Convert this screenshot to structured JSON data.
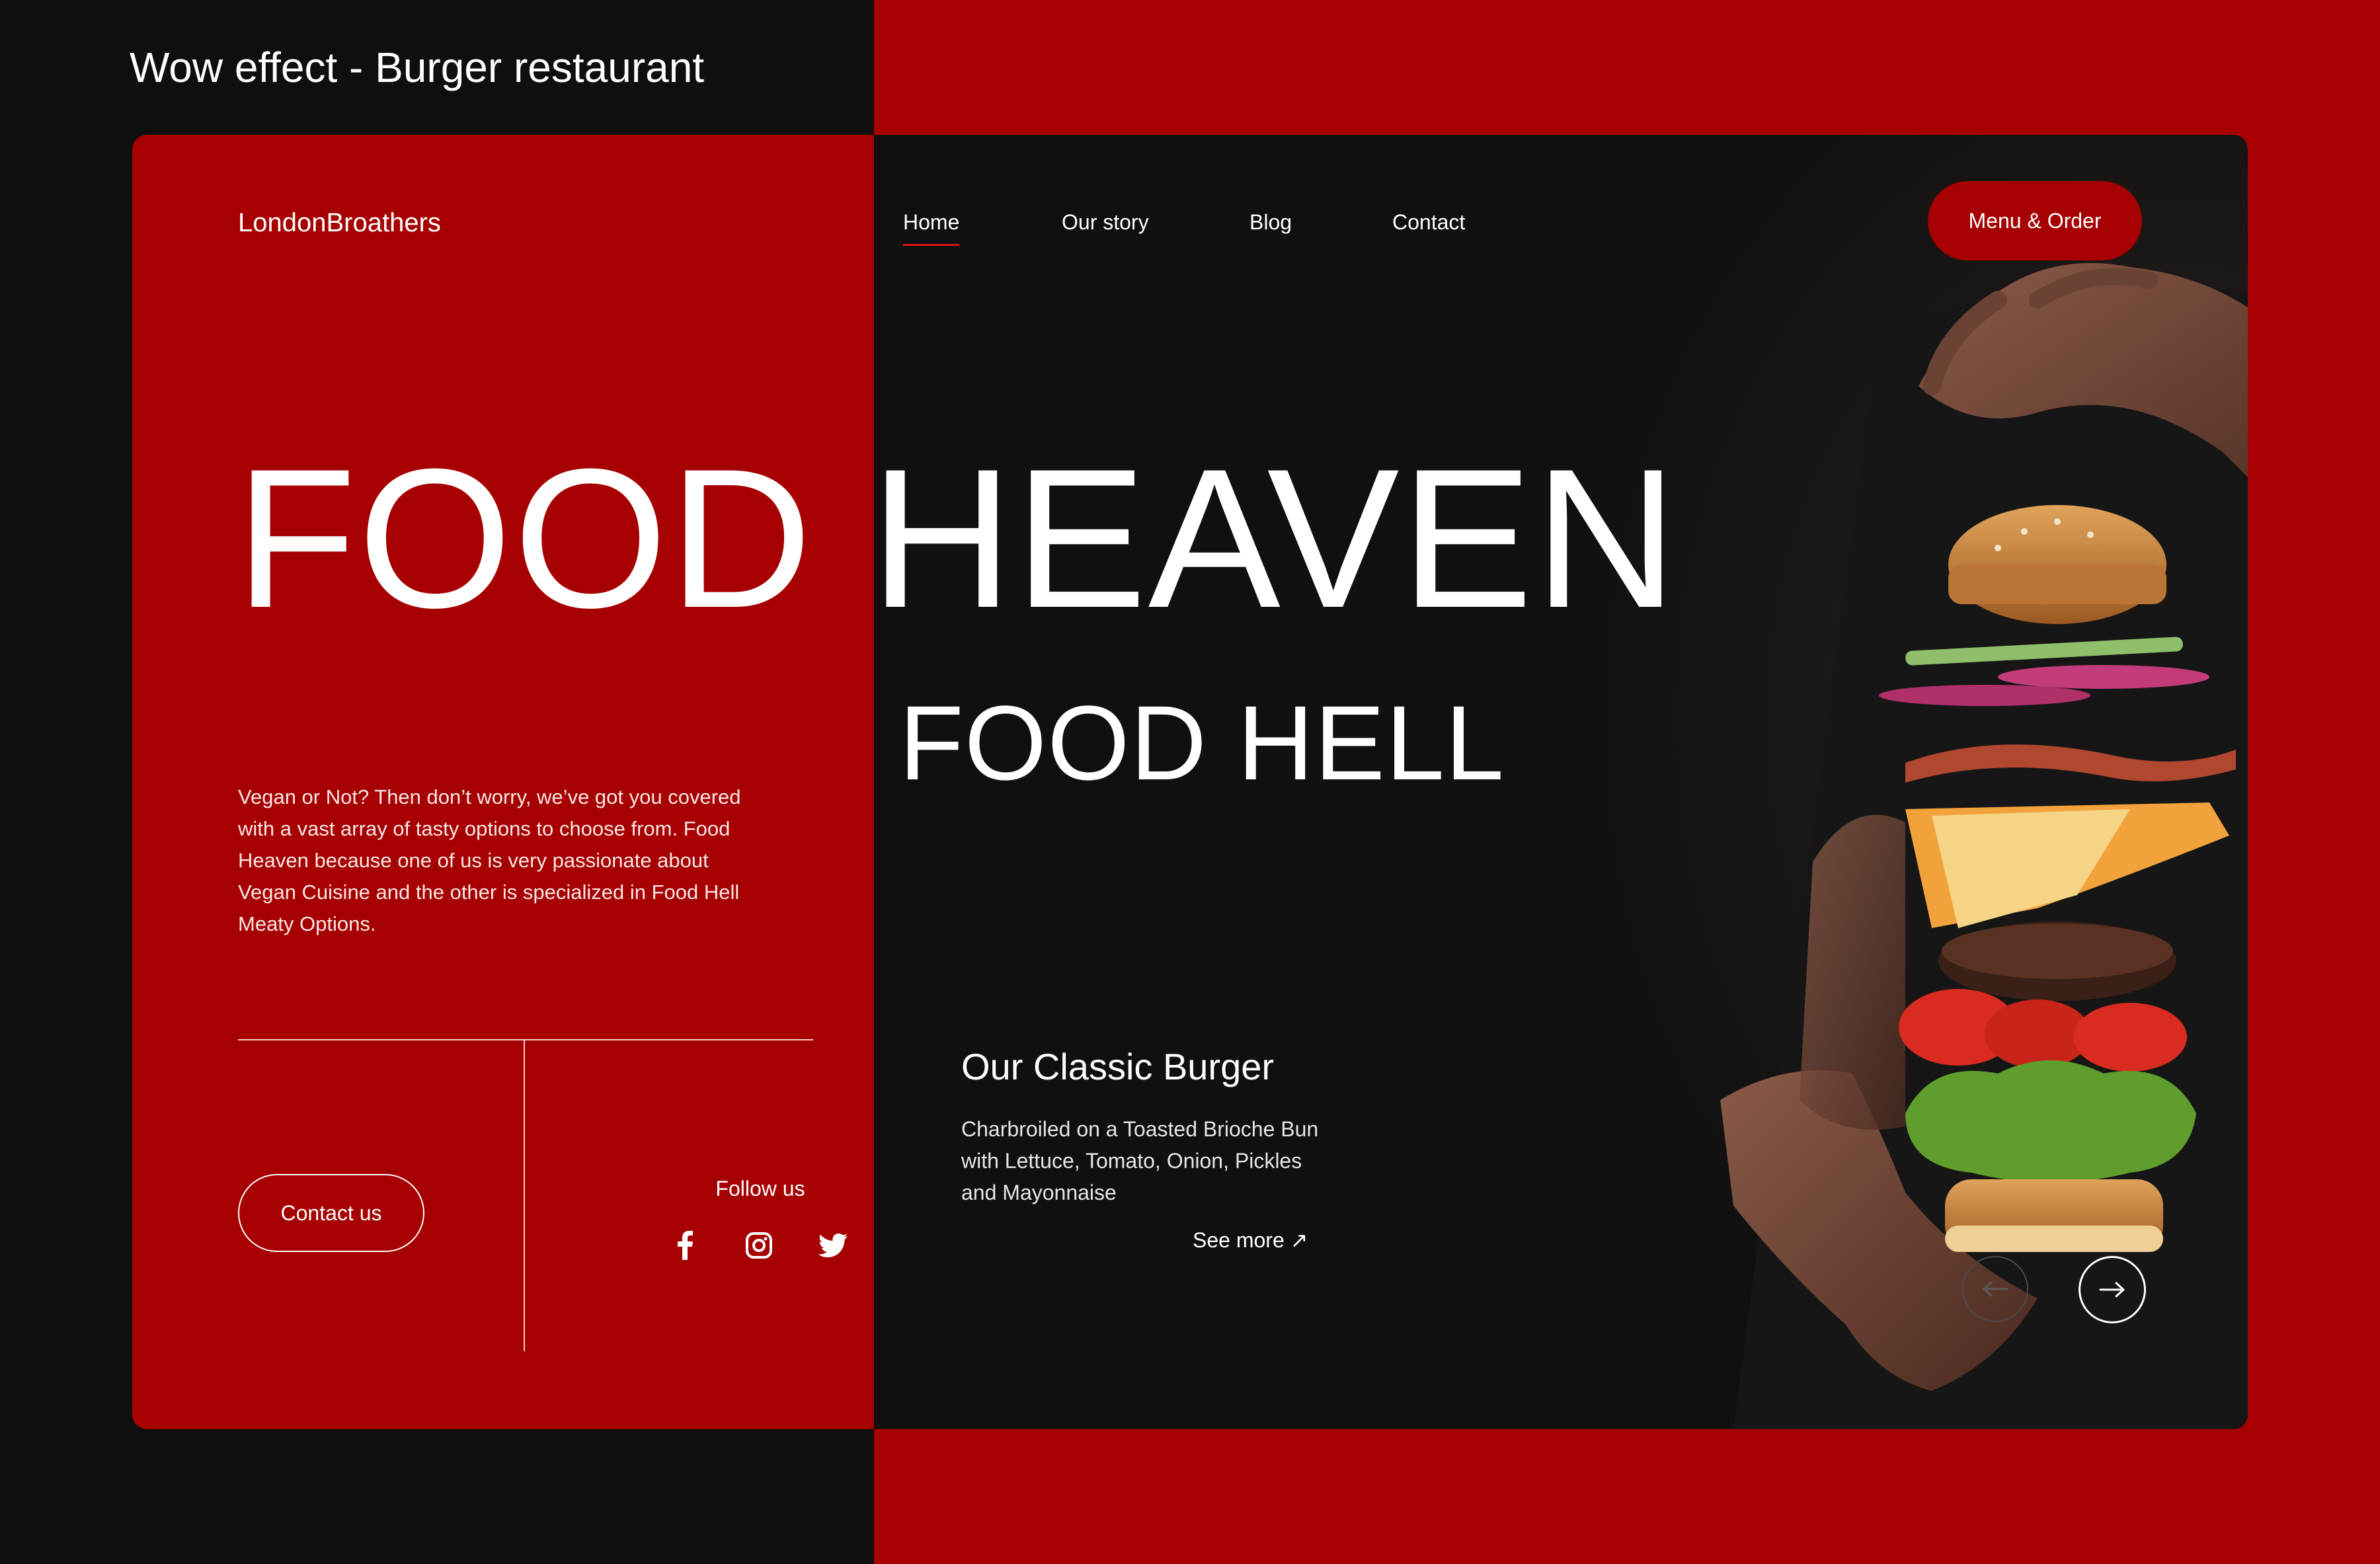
{
  "page": {
    "caption": "Wow effect - Burger restaurant"
  },
  "header": {
    "brand": "LondonBroathers",
    "nav": [
      {
        "label": "Home",
        "active": true
      },
      {
        "label": "Our story",
        "active": false
      },
      {
        "label": "Blog",
        "active": false
      },
      {
        "label": "Contact",
        "active": false
      }
    ],
    "cta_label": "Menu & Order"
  },
  "hero": {
    "headline": "FOOD HEAVEN",
    "subheadline": "FOOD HELL",
    "intro": "Vegan or Not? Then don’t worry, we’ve got you covered with a vast array of tasty options to choose from. Food Heaven because one of us is very passionate about Vegan Cuisine and the other is specialized in Food Hell Meaty Options."
  },
  "left_footer": {
    "contact_label": "Contact us",
    "follow_label": "Follow us",
    "social": [
      "facebook-icon",
      "instagram-icon",
      "twitter-icon"
    ]
  },
  "feature": {
    "title": "Our Classic Burger",
    "description": "Charbroiled on a Toasted Brioche Bun with Lettuce, Tomato, Onion, Pickles and Mayonnaise",
    "see_more": "See more ↗"
  },
  "colors": {
    "brand_red": "#a60000",
    "dark": "#101010"
  }
}
